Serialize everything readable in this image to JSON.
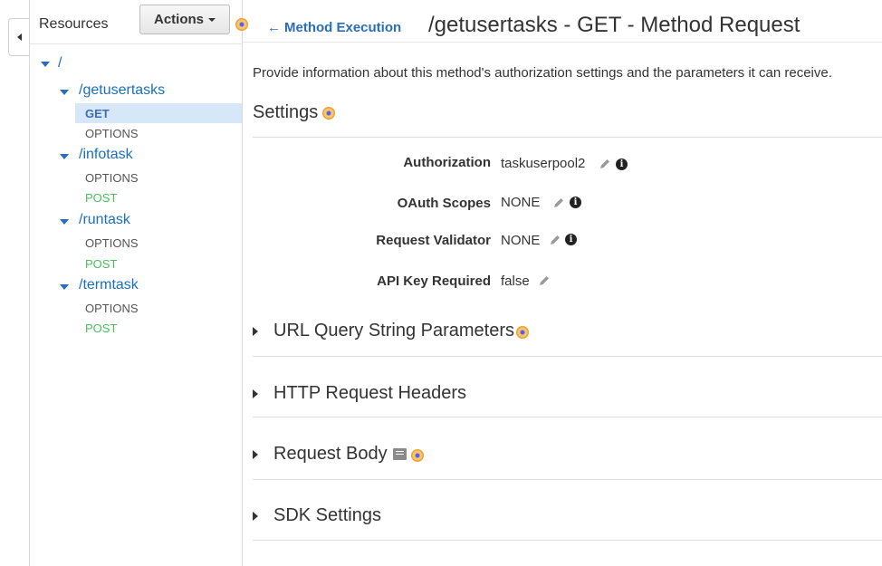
{
  "sidebar": {
    "title": "Resources",
    "actions_label": "Actions"
  },
  "tree": {
    "root": "/",
    "resources": [
      {
        "path": "/getusertasks",
        "methods": [
          "GET",
          "OPTIONS"
        ]
      },
      {
        "path": "/infotask",
        "methods": [
          "OPTIONS",
          "POST"
        ]
      },
      {
        "path": "/runtask",
        "methods": [
          "OPTIONS",
          "POST"
        ]
      },
      {
        "path": "/termtask",
        "methods": [
          "OPTIONS",
          "POST"
        ]
      }
    ],
    "selected": "GET"
  },
  "header": {
    "back_label": "Method Execution",
    "title": "/getusertasks - GET - Method Request"
  },
  "main": {
    "description": "Provide information about this method's authorization settings and the parameters it can receive.",
    "settings_heading": "Settings",
    "fields": [
      {
        "label": "Authorization",
        "value": "taskuserpool2"
      },
      {
        "label": "OAuth Scopes",
        "value": "NONE"
      },
      {
        "label": "Request Validator",
        "value": "NONE"
      },
      {
        "label": "API Key Required",
        "value": "false"
      }
    ],
    "sections": [
      "URL Query String Parameters",
      "HTTP Request Headers",
      "Request Body",
      "SDK Settings"
    ]
  },
  "colors": {
    "link": "#1a6fc0",
    "post": "#4bbd5c",
    "selected_bg": "#d6e7f8"
  }
}
